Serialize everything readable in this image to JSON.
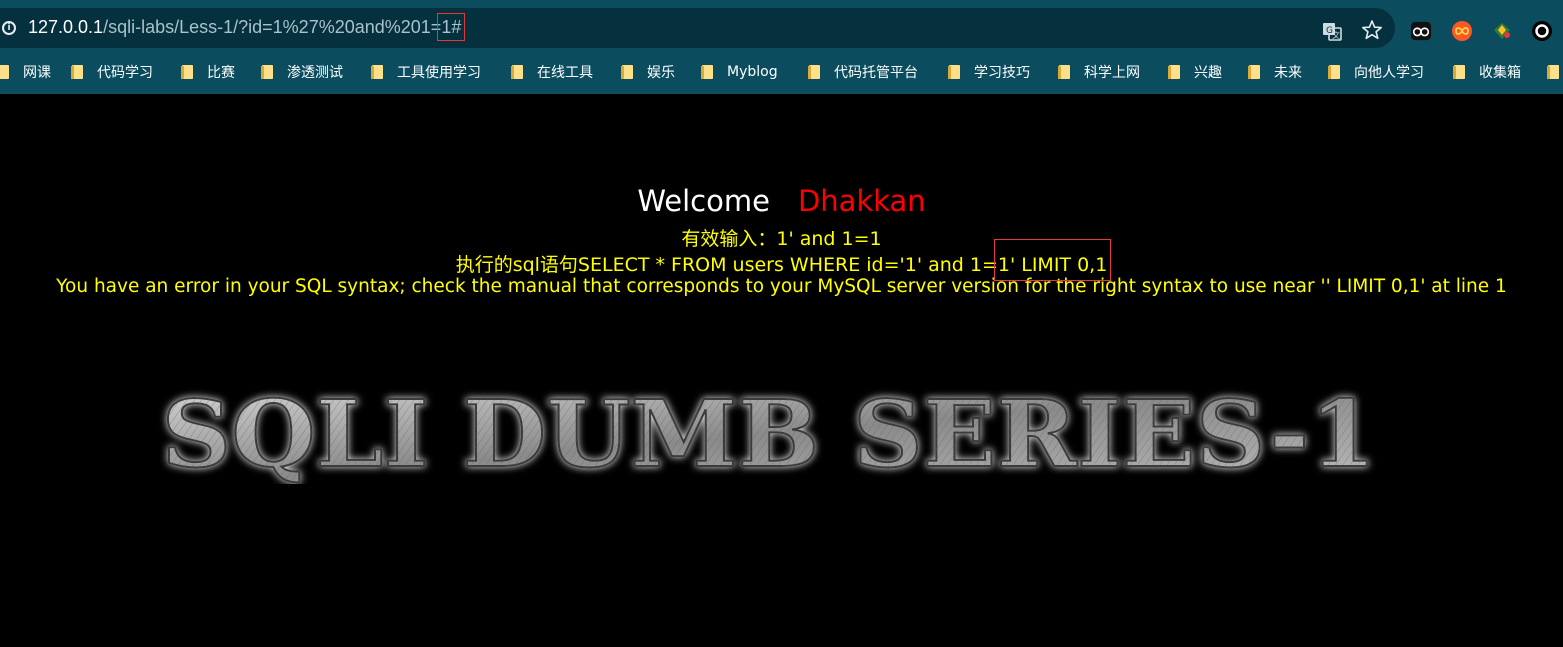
{
  "browser": {
    "url_host": "127.0.0.1",
    "url_path": "/sqli-labs/Less-1/?id=1%27%20and%201=",
    "url_highlight": "1#",
    "icons": [
      "info-icon",
      "translate-icon",
      "star-icon",
      "extension-owl-icon",
      "extension-infinity-icon",
      "extension-gem-icon",
      "extension-circle-icon"
    ]
  },
  "bookmarks": [
    {
      "label": "网课"
    },
    {
      "label": "代码学习"
    },
    {
      "label": "比赛"
    },
    {
      "label": "渗透测试"
    },
    {
      "label": "工具使用学习"
    },
    {
      "label": "在线工具"
    },
    {
      "label": "娱乐"
    },
    {
      "label": "Myblog"
    },
    {
      "label": "代码托管平台"
    },
    {
      "label": "学习技巧"
    },
    {
      "label": "科学上网"
    },
    {
      "label": "兴趣"
    },
    {
      "label": "未来"
    },
    {
      "label": "向他人学习"
    },
    {
      "label": "收集箱"
    }
  ],
  "page": {
    "welcome": "Welcome",
    "name": "Dhakkan",
    "valid_input": "有效输入：1' and 1=1",
    "sql_statement": "执行的sql语句SELECT * FROM users WHERE id='1' and 1=1' LIMIT 0,1",
    "error": "You have an error in your SQL syntax; check the manual that corresponds to your MySQL server version for the right syntax to use near '' LIMIT 0,1' at line 1",
    "banner_text": "SQLI DUMB SERIES-1"
  },
  "colors": {
    "chrome": "#0b4d5f",
    "addressbar": "#05303d",
    "highlight_box": "#e53935",
    "welcome_name": "#ff0000",
    "message_text": "#ffff00"
  }
}
